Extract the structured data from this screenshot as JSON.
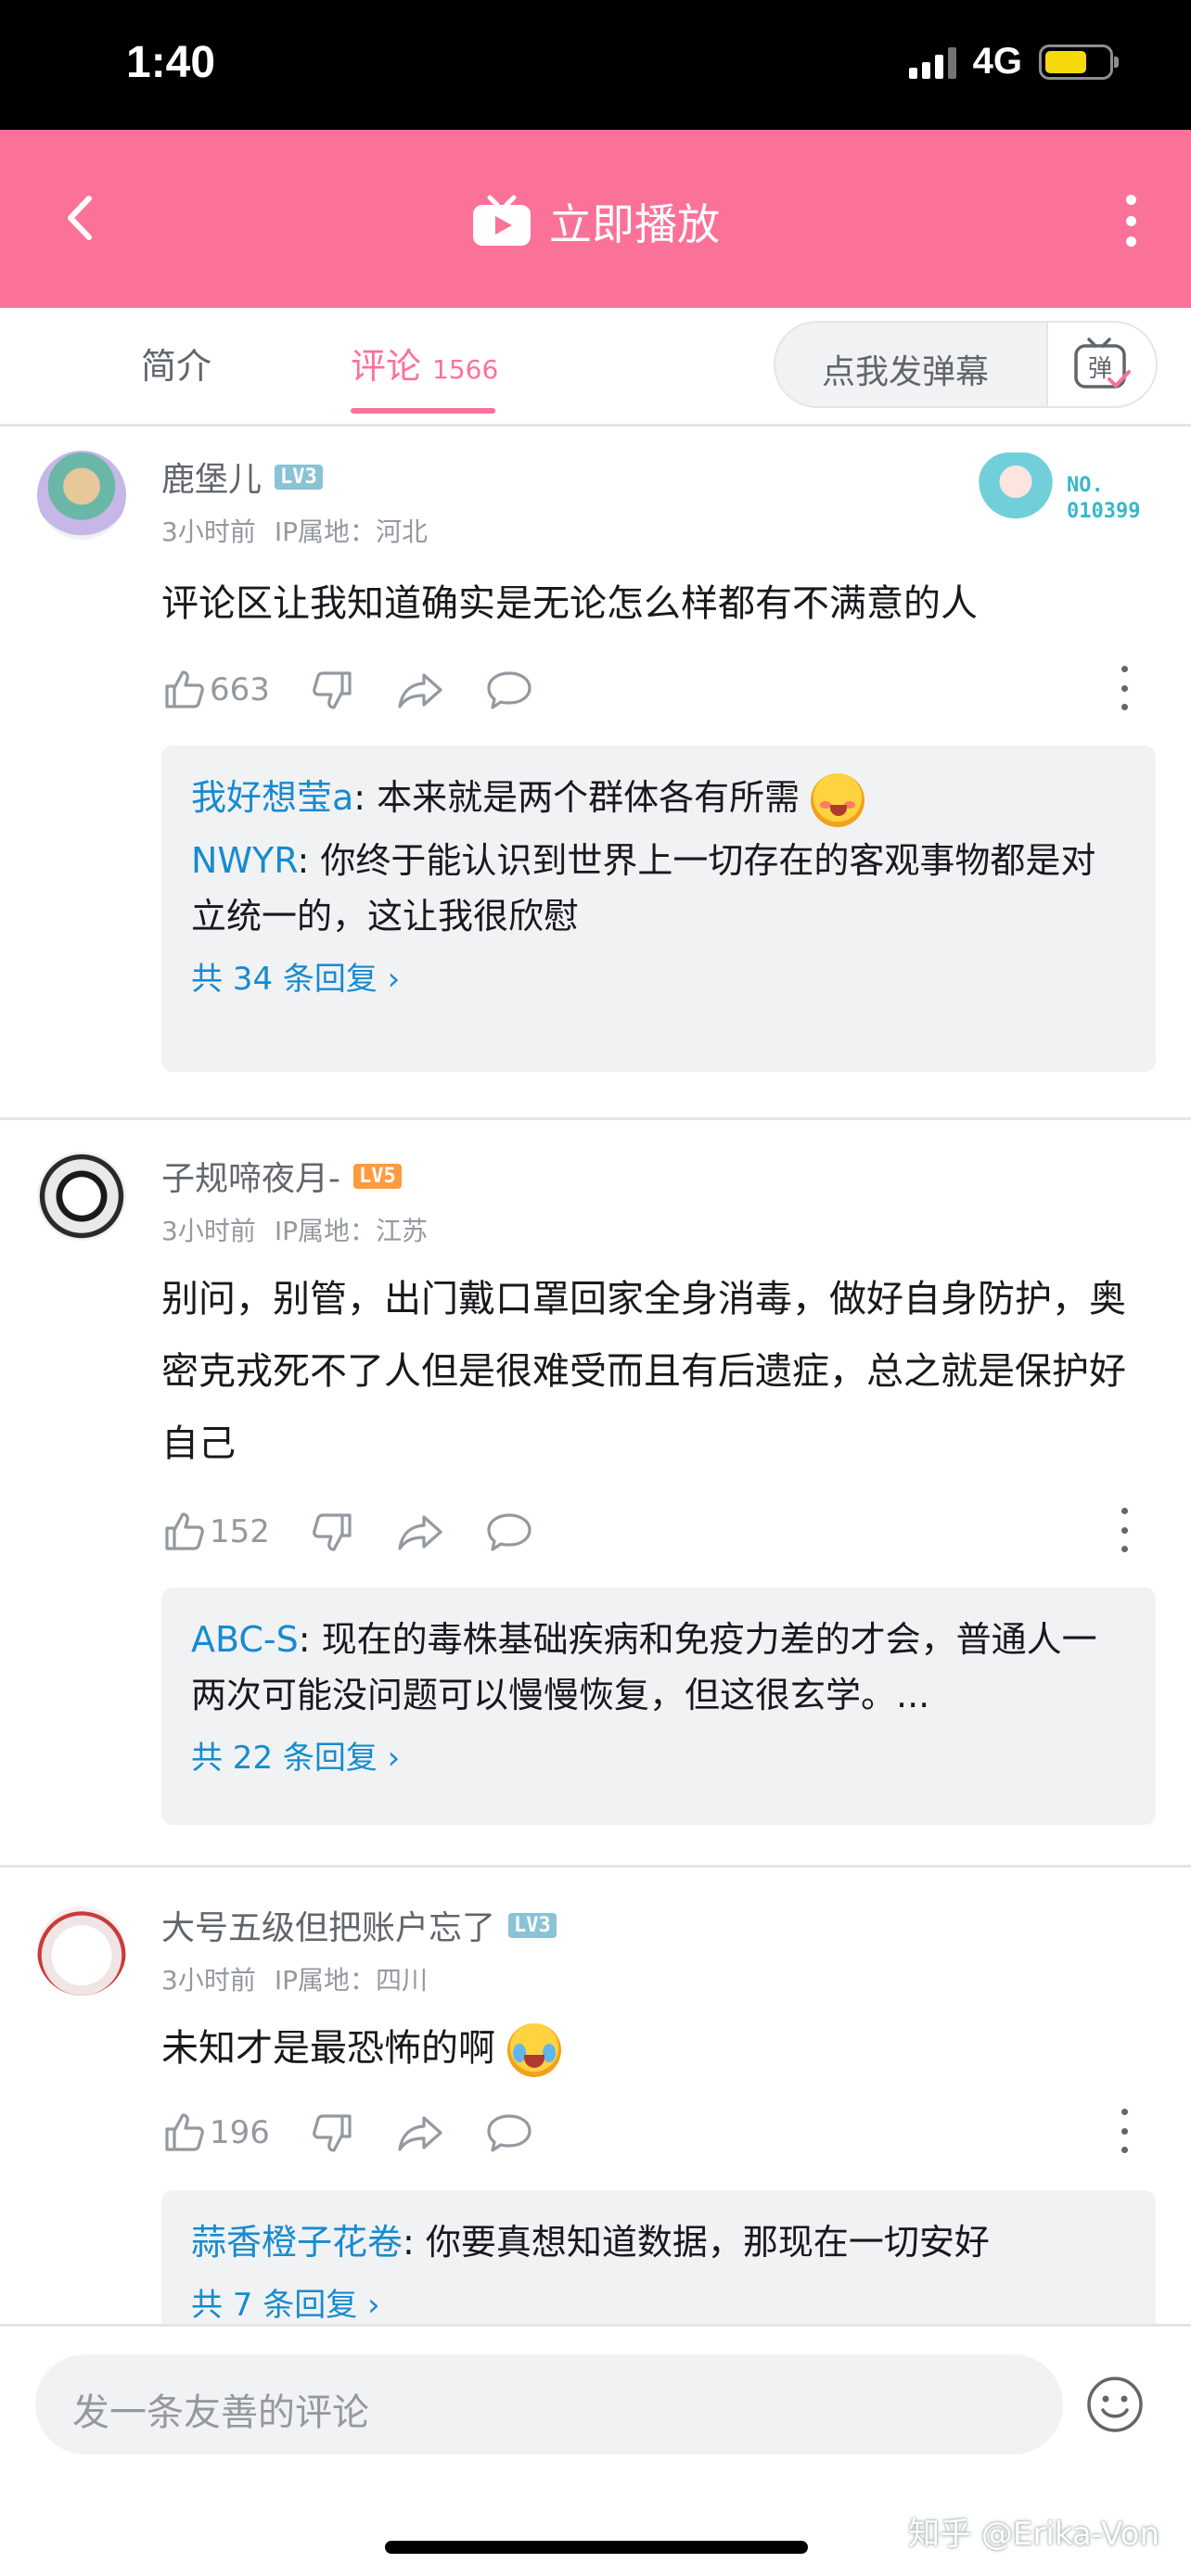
{
  "status": {
    "time": "1:40",
    "network": "4G"
  },
  "nav": {
    "title": "立即播放",
    "back_icon": "chevron-left-icon",
    "tv_icon": "tv-play-icon",
    "more_icon": "more-vertical-icon"
  },
  "tabs": {
    "intro": "简介",
    "comment": "评论",
    "comment_count": "1566",
    "danmu_placeholder": "点我发弹幕",
    "danmu_icon_char": "弹"
  },
  "comments": [
    {
      "user": "鹿堡儿",
      "level": "LV3",
      "level_color": "#8ac2d6",
      "time": "3小时前",
      "ip": "IP属地：河北",
      "text": "评论区让我知道确实是无论怎么样都有不满意的人",
      "likes": "663",
      "badge": {
        "no_label": "NO.",
        "no_value": "010399"
      },
      "replies": [
        {
          "name": "我好想莹a",
          "text": ": 本来就是两个群体各有所需"
        },
        {
          "name": "NWYR",
          "text": ": 你终于能认识到世界上一切存在的客观事物都是对立统一的，这让我很欣慰"
        }
      ],
      "more": "共 34 条回复 ›"
    },
    {
      "user": "子规啼夜月-",
      "level": "LV5",
      "level_color": "#ff9a3e",
      "time": "3小时前",
      "ip": "IP属地：江苏",
      "text": "别问，别管，出门戴口罩回家全身消毒，做好自身防护，奥密克戎死不了人但是很难受而且有后遗症，总之就是保护好自己",
      "likes": "152",
      "replies": [
        {
          "name": "ABC-S",
          "text": ": 现在的毒株基础疾病和免疫力差的才会，普通人一两次可能没问题可以慢慢恢复，但这很玄学。..."
        }
      ],
      "more": "共 22 条回复 ›"
    },
    {
      "user": "大号五级但把账户忘了",
      "level": "LV3",
      "level_color": "#8ac2d6",
      "time": "3小时前",
      "ip": "IP属地：四川",
      "text": "未知才是最恐怖的啊",
      "likes": "196",
      "replies": [
        {
          "name": "蒜香橙子花卷",
          "text": ": 你要真想知道数据，那现在一切安好"
        }
      ],
      "more": "共 7 条回复 ›"
    }
  ],
  "input": {
    "placeholder": "发一条友善的评论",
    "emoji_icon": "smiley-icon"
  },
  "watermark": "知乎 @Erika-Von",
  "colors": {
    "pink": "#fb7299",
    "link": "#178bcf",
    "gray": "#9499a0"
  }
}
